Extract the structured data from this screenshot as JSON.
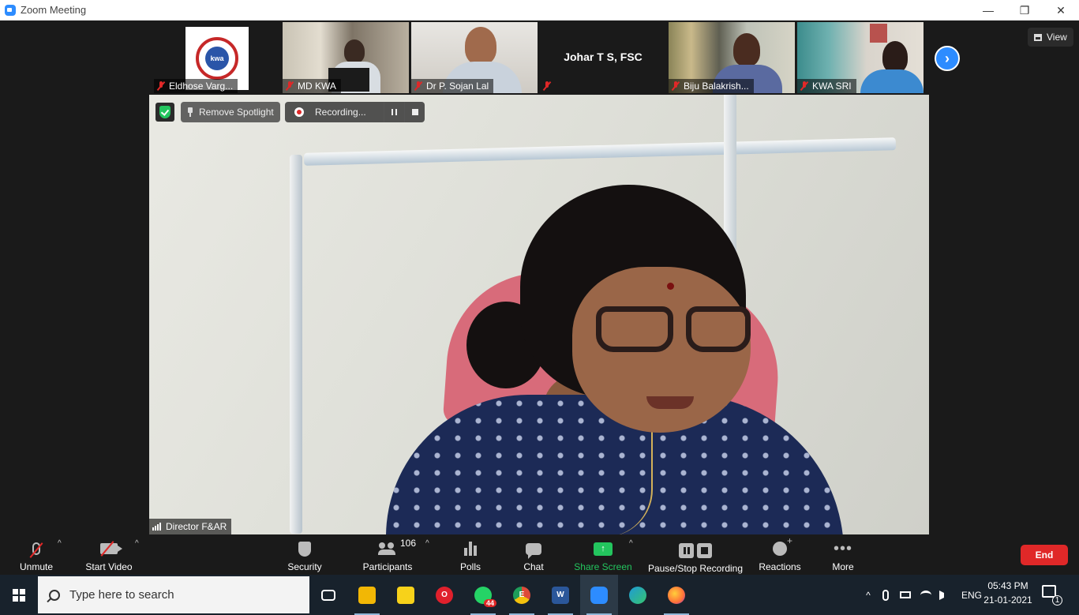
{
  "window": {
    "title": "Zoom Meeting",
    "minimize_glyph": "—",
    "restore_glyph": "❐",
    "close_glyph": "✕"
  },
  "gallery": {
    "tiles": [
      {
        "name": "Eldhose Varg...",
        "muted": true,
        "kind": "logo",
        "logo_text": "kwa"
      },
      {
        "name": "MD KWA",
        "muted": true,
        "kind": "video"
      },
      {
        "name": "Dr P. Sojan Lal",
        "muted": true,
        "kind": "video"
      },
      {
        "name": "",
        "display_name": "Johar T S,  FSC",
        "muted": true,
        "kind": "name-only"
      },
      {
        "name": "Biju Balakrish...",
        "muted": true,
        "kind": "video"
      },
      {
        "name": "KWA SRI",
        "muted": true,
        "kind": "video"
      }
    ],
    "next_glyph": "›",
    "view_label": "View"
  },
  "spotlight": {
    "remove_label": "Remove Spotlight",
    "recording_label": "Recording...",
    "speaker_name": "Director F&AR"
  },
  "toolbar": {
    "unmute": "Unmute",
    "start_video": "Start Video",
    "security": "Security",
    "participants": "Participants",
    "participant_count": "106",
    "polls": "Polls",
    "chat": "Chat",
    "share_screen": "Share Screen",
    "share_glyph": "↑",
    "caret_glyph": "^",
    "pause_stop_recording": "Pause/Stop Recording",
    "reactions": "Reactions",
    "more": "More",
    "more_glyph": "•••",
    "end": "End"
  },
  "taskbar": {
    "search_placeholder": "Type here to search",
    "apps": [
      {
        "id": "task-view",
        "label": "",
        "color": "#18222c"
      },
      {
        "id": "file-explorer",
        "label": "",
        "color": "#f2b705"
      },
      {
        "id": "sticky-notes",
        "label": "",
        "color": "#f7d21a"
      },
      {
        "id": "opera",
        "label": "O",
        "color": "#e0202c"
      },
      {
        "id": "whatsapp",
        "label": "",
        "color": "#25d366",
        "badge": "44"
      },
      {
        "id": "chrome",
        "label": "E",
        "color": "#dd4b39"
      },
      {
        "id": "word",
        "label": "W",
        "color": "#2b579a"
      },
      {
        "id": "zoom",
        "label": "",
        "color": "#2d8cff"
      },
      {
        "id": "edge",
        "label": "",
        "color": "#1f9ad6"
      },
      {
        "id": "firefox",
        "label": "",
        "color": "#ff7139"
      }
    ],
    "tray": {
      "chevron": "^",
      "language": "ENG",
      "time": "05:43 PM",
      "date": "21-01-2021",
      "notifications": "1"
    }
  }
}
